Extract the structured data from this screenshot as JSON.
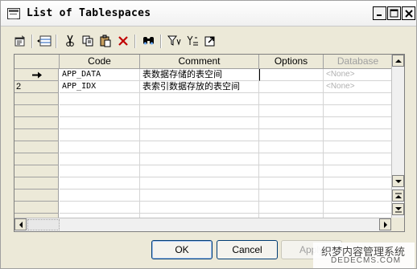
{
  "window": {
    "title": "List of Tablespaces"
  },
  "toolbar": {
    "items": [
      {
        "name": "properties-icon"
      },
      {
        "name": "add-row-icon"
      },
      {
        "name": "cut-icon"
      },
      {
        "name": "copy-icon"
      },
      {
        "name": "paste-icon"
      },
      {
        "name": "delete-icon"
      },
      {
        "name": "find-icon"
      },
      {
        "name": "filter-icon"
      },
      {
        "name": "sort-icon"
      },
      {
        "name": "export-icon"
      }
    ]
  },
  "grid": {
    "columns": [
      "Code",
      "Comment",
      "Options",
      "Database"
    ],
    "rows": [
      {
        "num": "",
        "current": true,
        "code": "APP_DATA",
        "comment": "表数据存储的表空间",
        "options": "",
        "database": "<None>"
      },
      {
        "num": "2",
        "current": false,
        "code": "APP_IDX",
        "comment": "表索引数据存放的表空间",
        "options": "",
        "database": "<None>"
      }
    ],
    "empty_rows": 11
  },
  "buttons": {
    "ok": "OK",
    "cancel": "Cancel",
    "apply": "Apply"
  },
  "watermark": {
    "line1": "织梦内容管理系统",
    "line2": "DEDECMS.COM"
  }
}
